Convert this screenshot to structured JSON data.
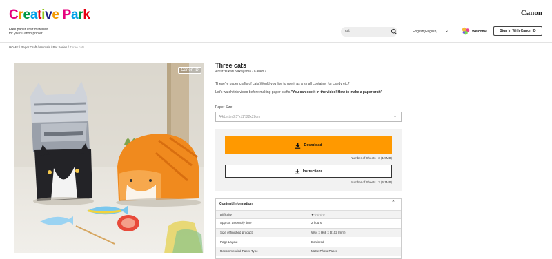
{
  "header": {
    "logo_letters": [
      {
        "ch": "C",
        "color": "#e6007e"
      },
      {
        "ch": "r",
        "color": "#f39800"
      },
      {
        "ch": "e",
        "color": "#009944"
      },
      {
        "ch": "a",
        "color": "#00a0e9"
      },
      {
        "ch": "t",
        "color": "#e60012"
      },
      {
        "ch": "i",
        "color": "#8fc31f"
      },
      {
        "ch": "v",
        "color": "#1d2088"
      },
      {
        "ch": "e",
        "color": "#f39800"
      },
      {
        "ch": " ",
        "color": "#000000"
      },
      {
        "ch": "P",
        "color": "#e6007e"
      },
      {
        "ch": "a",
        "color": "#00a0e9"
      },
      {
        "ch": "r",
        "color": "#009944"
      },
      {
        "ch": "k",
        "color": "#e60012"
      }
    ],
    "tagline_line1": "Free paper craft materials",
    "tagline_line2": "for your Canon printer.",
    "brand": "Canon",
    "search_value": "cat",
    "language": "English(English)",
    "welcome": "Welcome",
    "signin_label": "Sign In With Canon ID"
  },
  "breadcrumb": {
    "path": "HOME / Paper Craft / Animals / Pet Series / ",
    "current": "Three cats"
  },
  "image": {
    "badge": "Canon ID"
  },
  "product": {
    "title": "Three cats",
    "artist": "Artist:Yukari Nakayama / Kanko",
    "artist_arrow": "›",
    "desc1": "These're paper crafts of cats.Would you like to use it as a small container for candy etc?",
    "desc2_lead": "Let's watch this video before making paper crafts.",
    "desc2_bold": "\"You can see it in the video! How to make a paper craft\"",
    "paper_size_label": "Paper Size",
    "paper_size_value": "A4/Letter8.5\"x11\"/22x28cm",
    "download_label": "Download",
    "download_sheets": "Number of Sheets : 3 (1.9MB)",
    "instructions_label": "Instructions",
    "instructions_sheets": "Number of Sheets : 3 (6.1MB)"
  },
  "content_info": {
    "heading": "Content Information",
    "rows": [
      {
        "key": "Difficulty",
        "value": "★☆☆☆☆"
      },
      {
        "key": "Approx. assembly time",
        "value": "2 hours"
      },
      {
        "key": "Size of finished product",
        "value": "W64 x H68 x D102 (mm)"
      },
      {
        "key": "Page Layout",
        "value": "Bordered"
      },
      {
        "key": "Recommended Paper Type",
        "value": "Matte Photo Paper"
      }
    ]
  },
  "colors": {
    "accent": "#ff9900"
  }
}
